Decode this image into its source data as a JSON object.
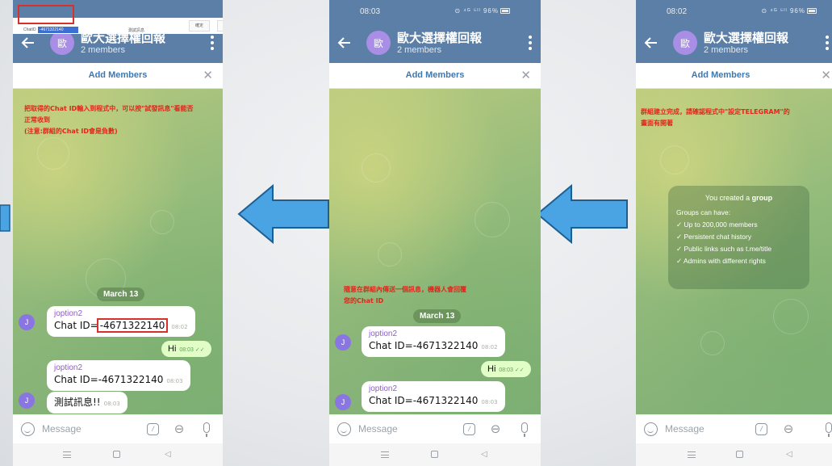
{
  "chat": {
    "title": "歐大選擇權回報",
    "members": "2 members",
    "avatar": "歐",
    "add_members": "Add Members",
    "close": "✕",
    "input_placeholder": "Message",
    "cmd": "/"
  },
  "status": {
    "middle_time": "08:03",
    "right_time": "08:02",
    "icons": "⊙ ⁴ᴳ ⁵ˡˡ 96%"
  },
  "left": {
    "desk_label": "ChatID",
    "desk_input": "-4671322140",
    "desk_test": "測試訊息",
    "desk_btn1": "確定",
    "desk_btn2": "離開",
    "annotation": [
      "把取得的Chat ID輸入到程式中，可以按\"試發訊息\"看能否",
      "正常收到",
      "(注意:群組的Chat ID會是負數)"
    ],
    "date": "March 13",
    "sender": "joption2",
    "msg1_prefix": "Chat ID=",
    "msg1_id": "-4671322140",
    "msg1_time": "08:02",
    "out_text": "Hi",
    "out_time": "08:03",
    "msg2": "Chat ID=-4671322140",
    "msg2_time": "08:03",
    "msg3": "測試訊息!!",
    "msg3_time": "08:03",
    "user_initial": "J"
  },
  "middle": {
    "annotation": [
      "隨意在群組內傳送一個訊息，機器人會回覆",
      "您的Chat ID"
    ],
    "date": "March 13",
    "sender": "joption2",
    "msg1": "Chat ID=-4671322140",
    "msg1_time": "08:02",
    "out_text": "Hi",
    "out_time": "08:03",
    "msg2": "Chat ID=-4671322140",
    "msg2_time": "08:03",
    "user_initial": "J"
  },
  "right": {
    "annotation": [
      "群組建立完成，請確認程式中\"設定TELEGRAM\"的",
      "畫面有開著"
    ],
    "info_title_pre": "You created a ",
    "info_title_bold": "group",
    "info_sub": "Groups can have:",
    "info_items": [
      "✓  Up to 200,000 members",
      "✓  Persistent chat history",
      "✓  Public links such as t.me/title",
      "✓  Admins with different rights"
    ]
  },
  "colors": {
    "arrow": "#4aa3e3",
    "header": "#5b7fa6",
    "annotation": "#e5241b"
  }
}
